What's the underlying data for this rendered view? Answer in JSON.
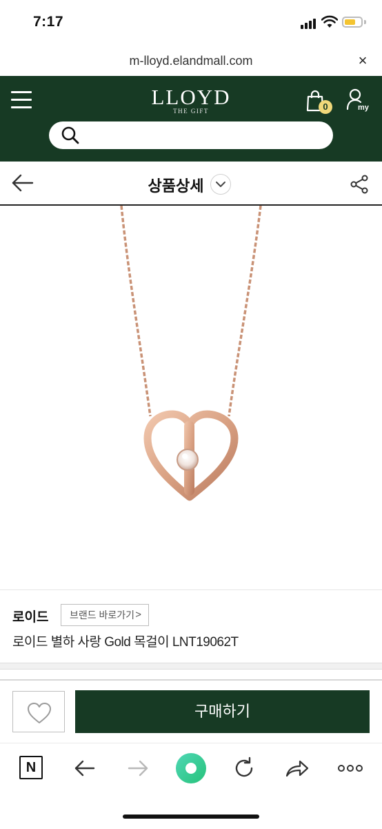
{
  "status_bar": {
    "time": "7:17"
  },
  "url_bar": {
    "url": "m-lloyd.elandmall.com",
    "close_label": "×"
  },
  "header": {
    "logo_main": "LLOYD",
    "logo_sub": "THE GIFT",
    "cart_count": "0",
    "user_label": "my",
    "search_placeholder": ""
  },
  "title_bar": {
    "title": "상품상세"
  },
  "product": {
    "brand": "로이드",
    "brand_link": "브랜드 바로가기",
    "brand_link_chevron": ">",
    "name": "로이드 별하 사랑 Gold 목걸이 LNT19062T"
  },
  "purchase_bar": {
    "buy_label": "구매하기"
  },
  "toolbar": {
    "naver_label": "N"
  },
  "colors": {
    "brand_green": "#173a24",
    "badge_yellow": "#f0d87a",
    "rose_gold": "#d9a183"
  }
}
